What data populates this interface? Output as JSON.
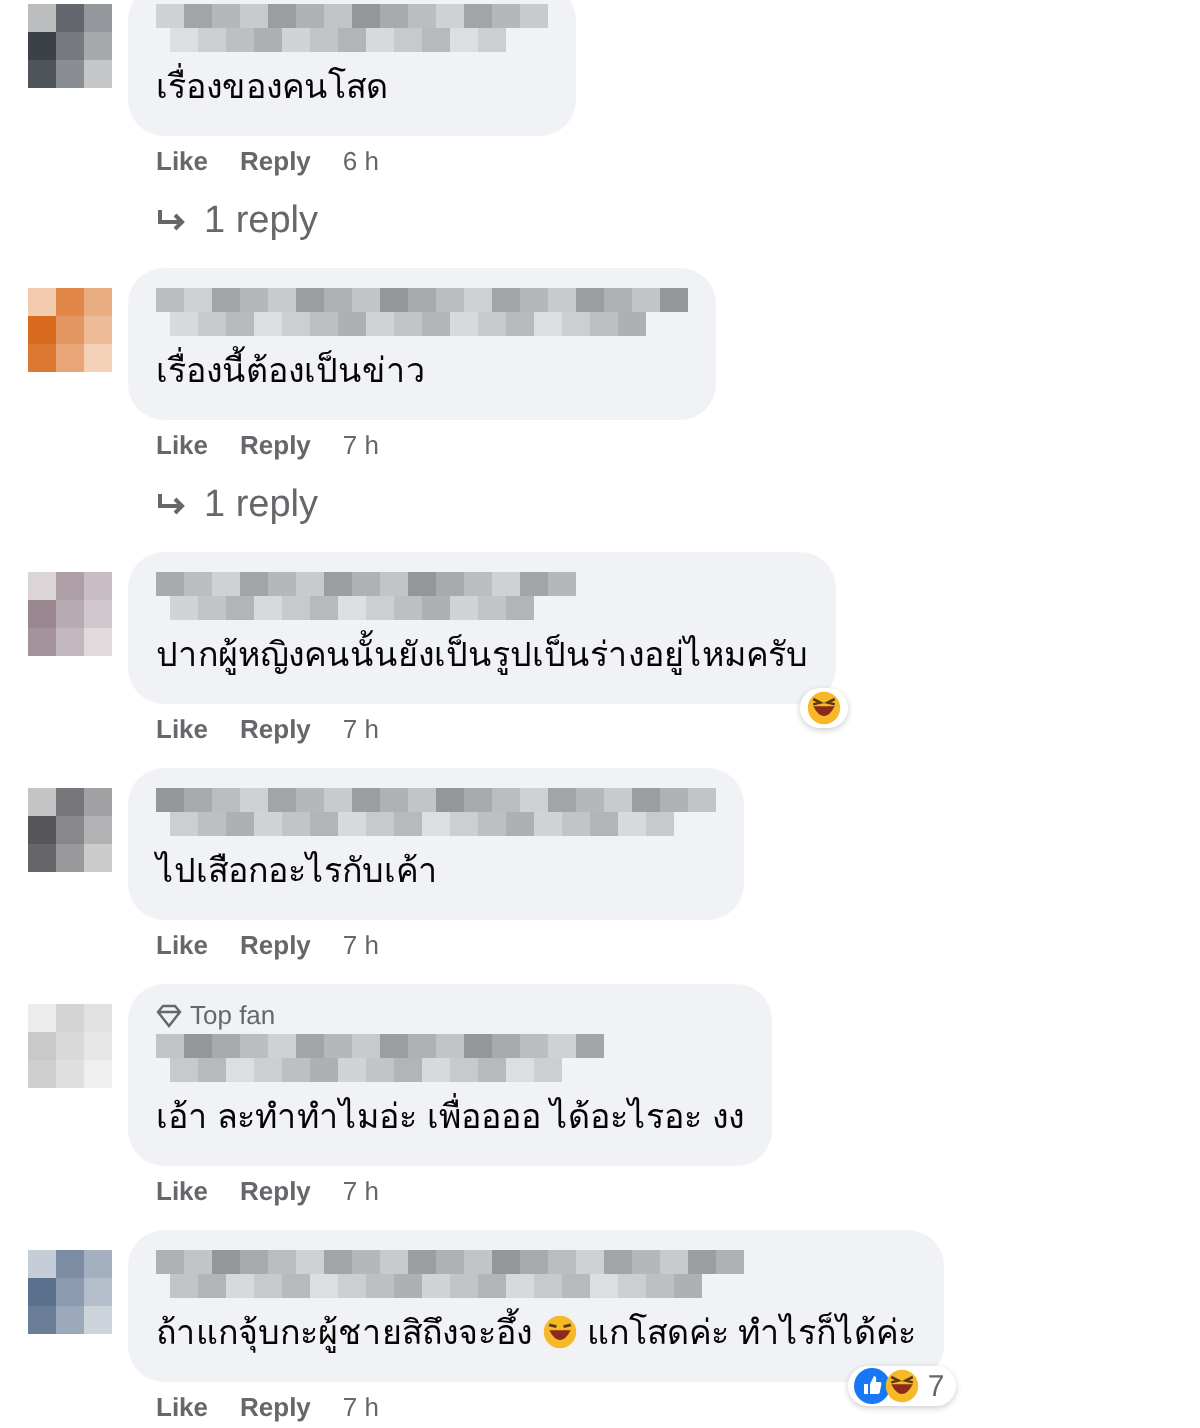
{
  "comments": [
    {
      "color": "#3c4148",
      "segments": [
        {
          "kind": "text",
          "text": "เรื่องของคนโสด"
        }
      ],
      "actions": [
        "Like",
        "Reply"
      ],
      "time": "6 h",
      "replies": "1 reply"
    },
    {
      "color": "#d9691c",
      "segments": [
        {
          "kind": "text",
          "text": "เรื่องนี้ต้องเป็นข่าว"
        }
      ],
      "actions": [
        "Like",
        "Reply"
      ],
      "time": "7 h",
      "replies": "1 reply"
    },
    {
      "color": "#9a8790",
      "segments": [
        {
          "kind": "text",
          "text": "ปากผู้หญิงคนนั้นยังเป็นรูปเป็นร่างอยู่ไหมครับ"
        }
      ],
      "reactions": [
        {
          "kind": "haha"
        }
      ],
      "actions": [
        "Like",
        "Reply"
      ],
      "time": "7 h"
    },
    {
      "color": "#55555a",
      "segments": [
        {
          "kind": "text",
          "text": "ไปเสือกอะไรกับเค้า"
        }
      ],
      "actions": [
        "Like",
        "Reply"
      ],
      "time": "7 h"
    },
    {
      "color": "#c9c9c9",
      "badge": "Top fan",
      "segments": [
        {
          "kind": "text",
          "text": "เอ้า ละทำทำไมอ่ะ เพื่ออออ ได้อะไรอะ งง"
        }
      ],
      "actions": [
        "Like",
        "Reply"
      ],
      "time": "7 h"
    },
    {
      "color": "#5a6f8c",
      "segments": [
        {
          "kind": "text",
          "text": "ถ้าแกจุ้บกะผู้ชายสิถึงจะอึ้ง "
        },
        {
          "kind": "emoji"
        },
        {
          "kind": "text",
          "text": " แกโสดค่ะ ทำไรก็ได้ค่ะ"
        }
      ],
      "reactions": [
        {
          "kind": "like"
        },
        {
          "kind": "haha"
        }
      ],
      "reaction_count": "7",
      "actions": [
        "Like",
        "Reply"
      ],
      "time": "7 h"
    }
  ]
}
